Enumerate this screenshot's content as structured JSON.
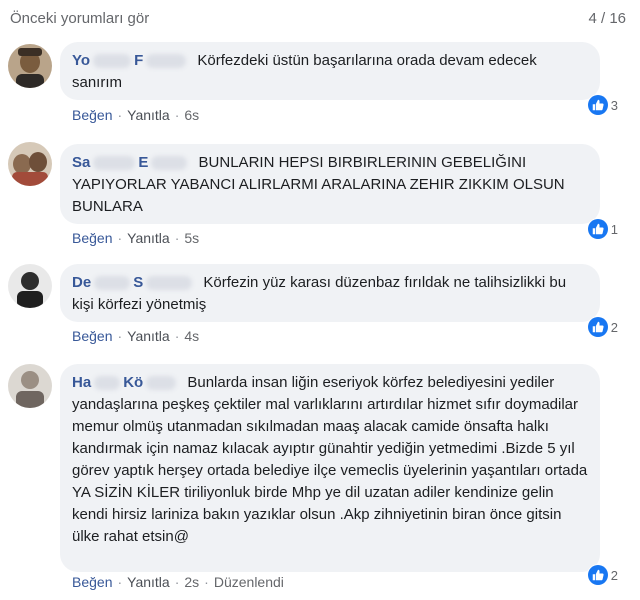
{
  "header": {
    "previous_comments_label": "Önceki yorumları gör",
    "count": "4 / 16"
  },
  "actions": {
    "like": "Beğen",
    "reply": "Yanıtla",
    "edited": "Düzenlendi",
    "separator": "·"
  },
  "colors": {
    "like_blue": "#1877f2",
    "author_blue": "#385898",
    "bubble_bg": "#f0f2f5",
    "meta_gray": "#65676b"
  },
  "comments": [
    {
      "author_visible": [
        "Yo",
        "F"
      ],
      "text": "Körfezdeki üstün başarılarına orada devam edecek sanırım",
      "time": "6s",
      "reactions": "3",
      "reaction_icon": "thumbs-up-icon"
    },
    {
      "author_visible": [
        "Sa",
        "E"
      ],
      "text": "BUNLARIN HEPSI BIRBIRLERININ GEBELIĞINI YAPIYORLAR YABANCI ALIRLARMI ARALARINA ZEHIR ZIKKIM OLSUN BUNLARA",
      "time": "5s",
      "reactions": "1",
      "reaction_icon": "thumbs-up-icon"
    },
    {
      "author_visible": [
        "De",
        "S"
      ],
      "text": "Körfezin yüz karası düzenbaz fırıldak ne talihsizlikki bu kişi körfezi yönetmiş",
      "time": "4s",
      "reactions": "2",
      "reaction_icon": "thumbs-up-icon"
    },
    {
      "author_visible": [
        "Ha",
        "Kö"
      ],
      "text": "Bunlarda insan liğin eseriyok körfez belediyesini yediler yandaşlarına peşkeş çektiler mal varlıklarını artırdılar hizmet sıfır doymadilar memur olmüş utanmadan sıkılmadan maaş alacak camide önsafta halkı kandırmak için namaz kılacak ayıptır günahtir yediğin yetmedimi .Bizde 5 yıl görev yaptık herşey ortada belediye ilçe vemeclis üyelerinin yaşantıları ortada YA SİZİN KİLER tiriliyonluk birde Mhp ye dil uzatan adiler kendinize gelin kendi hirsiz lariniza bakın yazıklar olsun .Akp zihniyetinin biran önce gitsin ülke rahat etsin@",
      "time": "2s",
      "reactions": "2",
      "reaction_icon": "thumbs-up-icon",
      "edited": true
    }
  ]
}
